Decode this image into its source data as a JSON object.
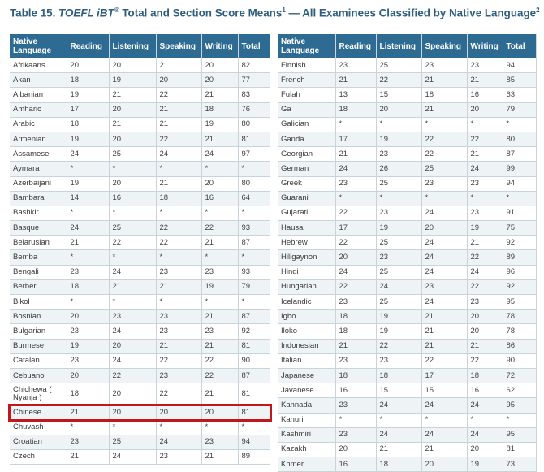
{
  "title": {
    "prefix": "Table 15. ",
    "italic": "TOEFL iBT",
    "reg": "®",
    "mid": " Total and Section Score Means",
    "sup1": "1",
    "suffix": " — All Examinees Classified by Native Language",
    "sup2": "2"
  },
  "columns": [
    "Native Language",
    "Reading",
    "Listening",
    "Speaking",
    "Writing",
    "Total"
  ],
  "left_rows": [
    [
      "Afrikaans",
      "20",
      "20",
      "21",
      "20",
      "82"
    ],
    [
      "Akan",
      "18",
      "19",
      "20",
      "20",
      "77"
    ],
    [
      "Albanian",
      "19",
      "21",
      "22",
      "21",
      "83"
    ],
    [
      "Amharic",
      "17",
      "20",
      "21",
      "18",
      "76"
    ],
    [
      "Arabic",
      "18",
      "21",
      "21",
      "19",
      "80"
    ],
    [
      "Armenian",
      "19",
      "20",
      "22",
      "21",
      "81"
    ],
    [
      "Assamese",
      "24",
      "25",
      "24",
      "24",
      "97"
    ],
    [
      "Aymara",
      "*",
      "*",
      "*",
      "*",
      "*"
    ],
    [
      "Azerbaijani",
      "19",
      "20",
      "21",
      "20",
      "80"
    ],
    [
      "Bambara",
      "14",
      "16",
      "18",
      "16",
      "64"
    ],
    [
      "Bashkir",
      "*",
      "*",
      "*",
      "*",
      "*"
    ],
    [
      "Basque",
      "24",
      "25",
      "22",
      "22",
      "93"
    ],
    [
      "Belarusian",
      "21",
      "22",
      "22",
      "21",
      "87"
    ],
    [
      "Bemba",
      "*",
      "*",
      "*",
      "*",
      "*"
    ],
    [
      "Bengali",
      "23",
      "24",
      "23",
      "23",
      "93"
    ],
    [
      "Berber",
      "18",
      "21",
      "21",
      "19",
      "79"
    ],
    [
      "Bikol",
      "*",
      "*",
      "*",
      "*",
      "*"
    ],
    [
      "Bosnian",
      "20",
      "23",
      "23",
      "21",
      "87"
    ],
    [
      "Bulgarian",
      "23",
      "24",
      "23",
      "23",
      "92"
    ],
    [
      "Burmese",
      "19",
      "20",
      "21",
      "21",
      "81"
    ],
    [
      "Catalan",
      "23",
      "24",
      "22",
      "22",
      "90"
    ],
    [
      "Cebuano",
      "20",
      "22",
      "23",
      "22",
      "87"
    ],
    [
      "Chichewa ( Nyanja )",
      "18",
      "20",
      "22",
      "21",
      "81"
    ],
    [
      "Chinese",
      "21",
      "20",
      "20",
      "20",
      "81"
    ],
    [
      "Chuvash",
      "*",
      "*",
      "*",
      "*",
      "*"
    ],
    [
      "Croatian",
      "23",
      "25",
      "24",
      "23",
      "94"
    ],
    [
      "Czech",
      "21",
      "24",
      "23",
      "21",
      "89"
    ]
  ],
  "right_rows": [
    [
      "Finnish",
      "23",
      "25",
      "23",
      "23",
      "94"
    ],
    [
      "French",
      "21",
      "22",
      "21",
      "21",
      "85"
    ],
    [
      "Fulah",
      "13",
      "15",
      "18",
      "16",
      "63"
    ],
    [
      "Ga",
      "18",
      "20",
      "21",
      "20",
      "79"
    ],
    [
      "Galician",
      "*",
      "*",
      "*",
      "*",
      "*"
    ],
    [
      "Ganda",
      "17",
      "19",
      "22",
      "22",
      "80"
    ],
    [
      "Georgian",
      "21",
      "23",
      "22",
      "21",
      "87"
    ],
    [
      "German",
      "24",
      "26",
      "25",
      "24",
      "99"
    ],
    [
      "Greek",
      "23",
      "25",
      "23",
      "23",
      "94"
    ],
    [
      "Guarani",
      "*",
      "*",
      "*",
      "*",
      "*"
    ],
    [
      "Gujarati",
      "22",
      "23",
      "24",
      "23",
      "91"
    ],
    [
      "Hausa",
      "17",
      "19",
      "20",
      "19",
      "75"
    ],
    [
      "Hebrew",
      "22",
      "25",
      "24",
      "21",
      "92"
    ],
    [
      "Hiligaynon",
      "20",
      "23",
      "24",
      "22",
      "89"
    ],
    [
      "Hindi",
      "24",
      "25",
      "24",
      "24",
      "96"
    ],
    [
      "Hungarian",
      "22",
      "24",
      "23",
      "22",
      "92"
    ],
    [
      "Icelandic",
      "23",
      "25",
      "24",
      "23",
      "95"
    ],
    [
      "Igbo",
      "18",
      "19",
      "21",
      "20",
      "78"
    ],
    [
      "Iloko",
      "18",
      "19",
      "21",
      "20",
      "78"
    ],
    [
      "Indonesian",
      "21",
      "22",
      "21",
      "21",
      "86"
    ],
    [
      "Italian",
      "23",
      "23",
      "22",
      "22",
      "90"
    ],
    [
      "Japanese",
      "18",
      "18",
      "17",
      "18",
      "72"
    ],
    [
      "Javanese",
      "16",
      "15",
      "15",
      "16",
      "62"
    ],
    [
      "Kannada",
      "23",
      "24",
      "24",
      "24",
      "95"
    ],
    [
      "Kanuri",
      "*",
      "*",
      "*",
      "*",
      "*"
    ],
    [
      "Kashmiri",
      "23",
      "24",
      "24",
      "24",
      "95"
    ],
    [
      "Kazakh",
      "20",
      "21",
      "21",
      "20",
      "81"
    ],
    [
      "Khmer",
      "16",
      "18",
      "20",
      "19",
      "73"
    ]
  ],
  "highlighted_language": "Chinese"
}
